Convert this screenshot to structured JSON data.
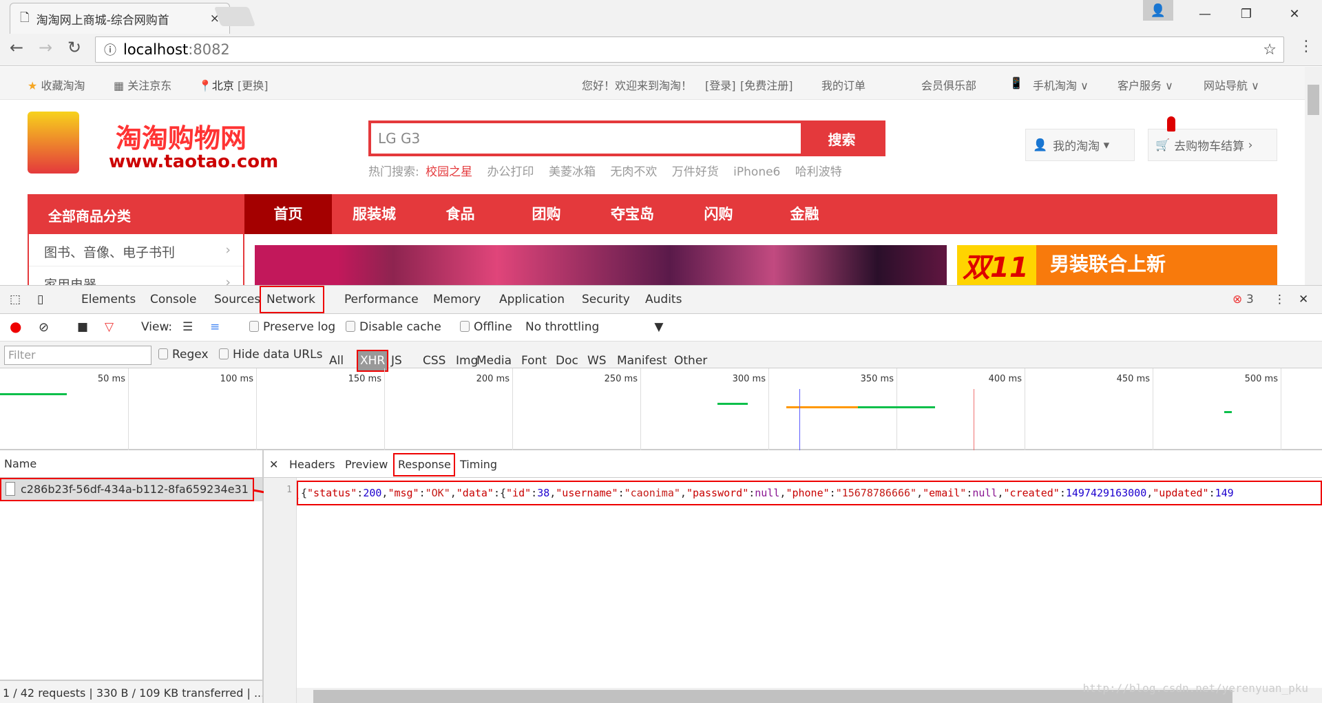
{
  "browser": {
    "tab_title": "淘淘网上商城-综合网购首",
    "url_host": "localhost",
    "url_port": ":8082"
  },
  "site": {
    "topbar": {
      "fav": "收藏淘淘",
      "follow": "关注京东",
      "city": "北京",
      "change": "[更换]",
      "greeting": "您好！欢迎来到淘淘！",
      "login": "[登录]",
      "register": "[免费注册]",
      "orders": "我的订单",
      "club": "会员俱乐部",
      "mobile": "手机淘淘",
      "service": "客户服务",
      "sitenav": "网站导航"
    },
    "logo_text": "淘淘购物网",
    "logo_url": "www.taotao.com",
    "search": {
      "value": "LG G3",
      "button": "搜索"
    },
    "hot": {
      "label": "热门搜索:",
      "items": [
        "校园之星",
        "办公打印",
        "美菱冰箱",
        "无肉不欢",
        "万件好货",
        "iPhone6",
        "哈利波特"
      ]
    },
    "my": "我的淘淘",
    "cart": "去购物车结算",
    "nav": {
      "category": "全部商品分类",
      "items": [
        "首页",
        "服装城",
        "食品",
        "团购",
        "夺宝岛",
        "闪购",
        "金融"
      ]
    },
    "menu": [
      "图书、音像、电子书刊",
      "家用电器"
    ],
    "banner2_text": "男装联合上新",
    "banner2_badge": "双11"
  },
  "devtools": {
    "tabs": [
      "Elements",
      "Console",
      "Sources",
      "Network",
      "Performance",
      "Memory",
      "Application",
      "Security",
      "Audits"
    ],
    "active_tab": "Network",
    "error_count": "3",
    "toolbar": {
      "view": "View:",
      "preserve": "Preserve log",
      "disable_cache": "Disable cache",
      "offline": "Offline",
      "throttling": "No throttling"
    },
    "filter": {
      "placeholder": "Filter",
      "regex": "Regex",
      "hide_data": "Hide data URLs",
      "types": [
        "All",
        "XHR",
        "JS",
        "CSS",
        "Img",
        "Media",
        "Font",
        "Doc",
        "WS",
        "Manifest",
        "Other"
      ],
      "active_type": "XHR"
    },
    "timeline": {
      "ticks": [
        "50 ms",
        "100 ms",
        "150 ms",
        "200 ms",
        "250 ms",
        "300 ms",
        "350 ms",
        "400 ms",
        "450 ms",
        "500 ms"
      ],
      "bars": [
        {
          "start": 0,
          "end": 26,
          "color": "#0bbf4a"
        },
        {
          "start": 280,
          "end": 292,
          "color": "#0bbf4a"
        },
        {
          "start": 307,
          "end": 335,
          "color": "#ff9800"
        },
        {
          "start": 335,
          "end": 365,
          "color": "#0bbf4a"
        },
        {
          "start": 478,
          "end": 481,
          "color": "#0bbf4a"
        }
      ],
      "dom_content_loaded_ms": 312,
      "load_ms": 380
    },
    "name_header": "Name",
    "request": "c286b23f-56df-434a-b112-8fa659234e31",
    "detail_tabs": [
      "Headers",
      "Preview",
      "Response",
      "Timing"
    ],
    "active_detail": "Response",
    "line_no": "1",
    "response_tokens": [
      [
        "p",
        "{"
      ],
      [
        "k",
        "\"status\""
      ],
      [
        "p",
        ":"
      ],
      [
        "n",
        "200"
      ],
      [
        "p",
        ","
      ],
      [
        "k",
        "\"msg\""
      ],
      [
        "p",
        ":"
      ],
      [
        "s",
        "\"OK\""
      ],
      [
        "p",
        ","
      ],
      [
        "k",
        "\"data\""
      ],
      [
        "p",
        ":{"
      ],
      [
        "k",
        "\"id\""
      ],
      [
        "p",
        ":"
      ],
      [
        "n",
        "38"
      ],
      [
        "p",
        ","
      ],
      [
        "k",
        "\"username\""
      ],
      [
        "p",
        ":"
      ],
      [
        "s",
        "\"caonima\""
      ],
      [
        "p",
        ","
      ],
      [
        "k",
        "\"password\""
      ],
      [
        "p",
        ":"
      ],
      [
        "nl",
        "null"
      ],
      [
        "p",
        ","
      ],
      [
        "k",
        "\"phone\""
      ],
      [
        "p",
        ":"
      ],
      [
        "s",
        "\"15678786666\""
      ],
      [
        "p",
        ","
      ],
      [
        "k",
        "\"email\""
      ],
      [
        "p",
        ":"
      ],
      [
        "nl",
        "null"
      ],
      [
        "p",
        ","
      ],
      [
        "k",
        "\"created\""
      ],
      [
        "p",
        ":"
      ],
      [
        "n",
        "1497429163000"
      ],
      [
        "p",
        ","
      ],
      [
        "k",
        "\"updated\""
      ],
      [
        "p",
        ":"
      ],
      [
        "n",
        "149"
      ]
    ],
    "status": "1 / 42 requests | 330 B / 109 KB transferred | ...",
    "watermark": "http://blog.csdn.net/yerenyuan_pku"
  }
}
